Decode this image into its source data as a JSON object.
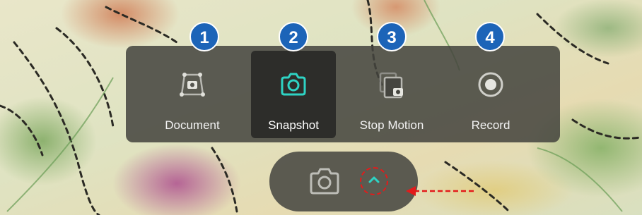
{
  "modes": [
    {
      "id": 1,
      "label": "Document",
      "icon": "document-scan-icon",
      "selected": false
    },
    {
      "id": 2,
      "label": "Snapshot",
      "icon": "camera-icon",
      "selected": true
    },
    {
      "id": 3,
      "label": "Stop Motion",
      "icon": "stop-motion-icon",
      "selected": false
    },
    {
      "id": 4,
      "label": "Record",
      "icon": "record-icon",
      "selected": false
    }
  ],
  "badges": [
    "1",
    "2",
    "3",
    "4"
  ],
  "capture": {
    "icon": "camera-icon",
    "expand_icon": "chevron-up-icon"
  },
  "colors": {
    "accent": "#2ed3c4",
    "badge": "#1c64b8",
    "callout": "#e31b1b"
  }
}
